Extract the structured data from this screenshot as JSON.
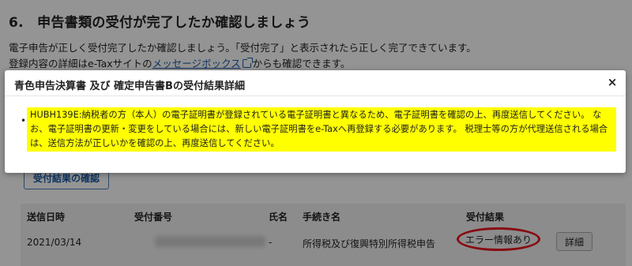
{
  "page": {
    "section_title": "6.　申告書類の受付が完了したか確認しましょう",
    "desc_line1": "電子申告が正しく受付完了したか確認しましょう。「受付完了」と表示されたら正しく完了できています。",
    "desc_line2_pre": "登録内容の詳細はe-Taxサイトの",
    "desc_line2_link": "メッセージボックス",
    "desc_line2_post": "からも確認できます。",
    "check_button": "受付結果の確認"
  },
  "table": {
    "headers": {
      "date": "送信日時",
      "number": "受付番号",
      "name": "氏名",
      "procedure": "手続き名",
      "result": "受付結果"
    },
    "row": {
      "date": "2021/03/14",
      "name": "-",
      "procedure": "所得税及び復興特別所得税申告",
      "result": "エラー情報あり",
      "detail": "詳細"
    }
  },
  "modal": {
    "title": "青色申告決算書 及び 確定申告書Bの受付結果詳細",
    "close": "×",
    "bullet": "•",
    "message": "HUBH139E:納税者の方（本人）の電子証明書が登録されている電子証明書と異なるため、電子証明書を確認の上、再度送信してください。 なお、電子証明書の更新・変更をしている場合には、新しい電子証明書をe-Taxへ再登録する必要があります。 税理士等の方が代理送信される場合は、送信方法が正しいかを確認の上、再度送信してください。"
  },
  "colors": {
    "highlight": "#ffff00",
    "error_circle": "#e8141e",
    "link": "#1a5aa6"
  }
}
